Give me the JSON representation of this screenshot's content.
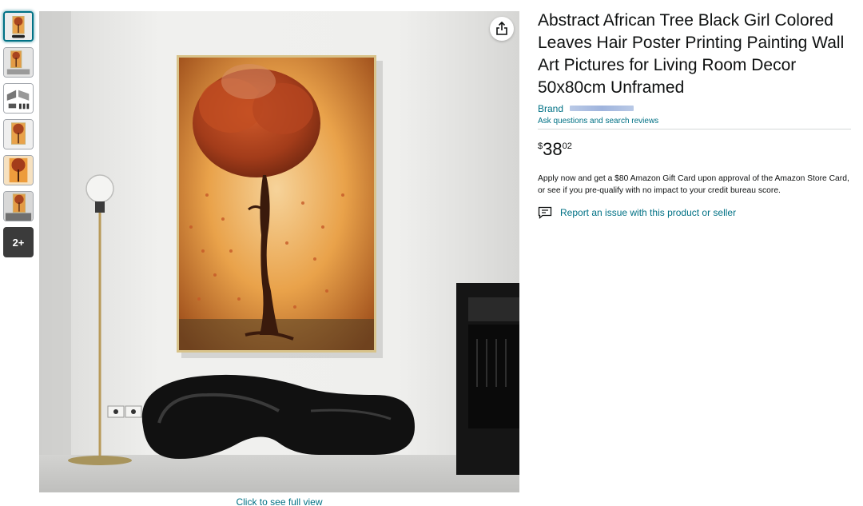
{
  "product": {
    "title": "Abstract African Tree Black Girl Colored Leaves Hair Poster Printing Painting Wall Art Pictures for Living Room Decor 50x80cm Unframed",
    "brand_label": "Brand",
    "ask_link": "Ask questions and search reviews",
    "price": {
      "symbol": "$",
      "whole": "38",
      "fraction": "02"
    },
    "promo_text": "Apply now and get a $80 Amazon Gift Card upon approval of the Amazon Store Card, or see if you pre-qualify with no impact to your credit bureau score.",
    "report_link": "Report an issue with this product or seller"
  },
  "gallery": {
    "more_label": "2+",
    "full_view_label": "Click to see full view",
    "thumbnail_count": 6
  },
  "icons": {
    "share": "share-icon",
    "report": "report-icon"
  },
  "colors": {
    "link": "#007185",
    "text": "#0f1111",
    "divider": "#d5d9d9"
  }
}
